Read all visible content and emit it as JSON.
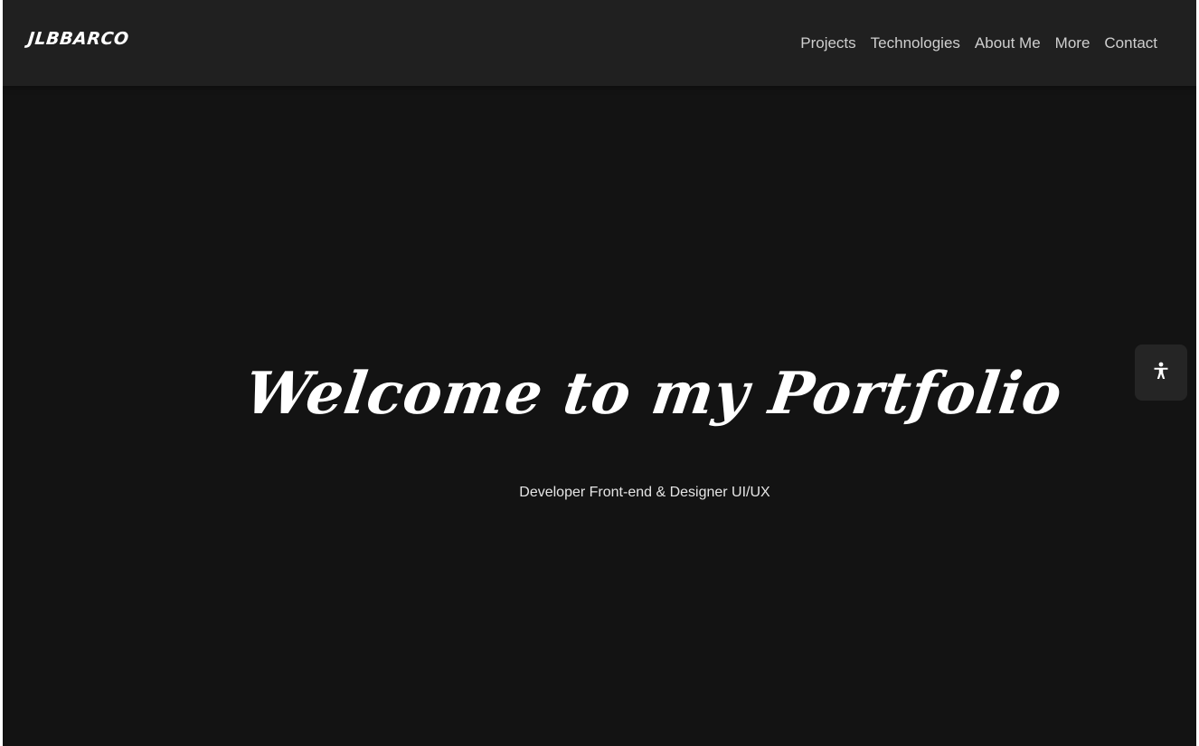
{
  "navbar": {
    "brand": "JLBBARCO",
    "links": [
      {
        "label": "Projects"
      },
      {
        "label": "Technologies"
      },
      {
        "label": "About Me"
      },
      {
        "label": "More"
      },
      {
        "label": "Contact"
      }
    ]
  },
  "hero": {
    "title": "Welcome to my Portfolio",
    "subtitle": "Developer Front-end & Designer UI/UX"
  },
  "accessibility_button": {
    "icon": "accessibility-icon"
  },
  "colors": {
    "background": "#131313",
    "navbar": "#202020",
    "nav_text": "#cfcfcf",
    "text": "#ffffff",
    "floating_button": "#252525"
  }
}
